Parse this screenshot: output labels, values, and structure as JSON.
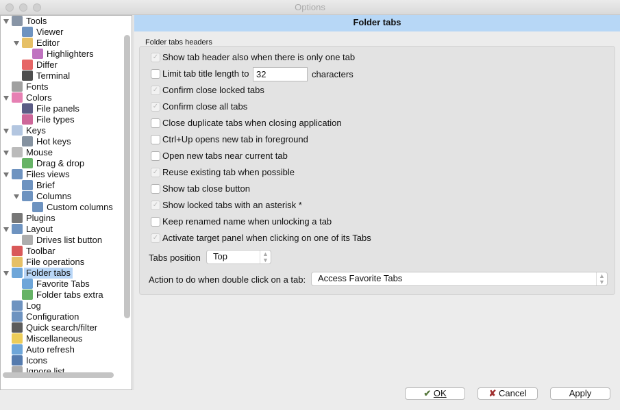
{
  "window": {
    "title": "Options"
  },
  "tree": [
    {
      "label": "Tools",
      "level": 0,
      "expanded": true,
      "icon": "tools-icon",
      "color": "#6a7a90"
    },
    {
      "label": "Viewer",
      "level": 1,
      "icon": "viewer-icon",
      "color": "#4a78b0"
    },
    {
      "label": "Editor",
      "level": 1,
      "expanded": true,
      "icon": "editor-icon",
      "color": "#e0b040"
    },
    {
      "label": "Highlighters",
      "level": 2,
      "icon": "highlighters-icon",
      "color": "#b050b0"
    },
    {
      "label": "Differ",
      "level": 1,
      "icon": "differ-icon",
      "color": "#e04040"
    },
    {
      "label": "Terminal",
      "level": 1,
      "icon": "terminal-icon",
      "color": "#222222"
    },
    {
      "label": "Fonts",
      "level": 0,
      "icon": "fonts-icon",
      "color": "#888888"
    },
    {
      "label": "Colors",
      "level": 0,
      "expanded": true,
      "icon": "colors-icon",
      "color": "#e060a0"
    },
    {
      "label": "File panels",
      "level": 1,
      "icon": "file-panels-icon",
      "color": "#333366"
    },
    {
      "label": "File types",
      "level": 1,
      "icon": "file-types-icon",
      "color": "#c04080"
    },
    {
      "label": "Keys",
      "level": 0,
      "expanded": true,
      "icon": "keyboard-icon",
      "color": "#a0b8d8"
    },
    {
      "label": "Hot keys",
      "level": 1,
      "icon": "hot-keys-icon",
      "color": "#667788"
    },
    {
      "label": "Mouse",
      "level": 0,
      "expanded": true,
      "icon": "mouse-icon",
      "color": "#aaaaaa"
    },
    {
      "label": "Drag & drop",
      "level": 1,
      "icon": "drag-drop-icon",
      "color": "#40a040"
    },
    {
      "label": "Files views",
      "level": 0,
      "expanded": true,
      "icon": "files-views-icon",
      "color": "#4a78b0"
    },
    {
      "label": "Brief",
      "level": 1,
      "icon": "brief-icon",
      "color": "#4a78b0"
    },
    {
      "label": "Columns",
      "level": 1,
      "expanded": true,
      "icon": "columns-icon",
      "color": "#4a78b0"
    },
    {
      "label": "Custom columns",
      "level": 2,
      "icon": "custom-columns-icon",
      "color": "#4a78b0"
    },
    {
      "label": "Plugins",
      "level": 0,
      "icon": "plugins-icon",
      "color": "#555555"
    },
    {
      "label": "Layout",
      "level": 0,
      "expanded": true,
      "icon": "layout-icon",
      "color": "#4a78b0"
    },
    {
      "label": "Drives list button",
      "level": 1,
      "icon": "drives-list-icon",
      "color": "#999999"
    },
    {
      "label": "Toolbar",
      "level": 0,
      "icon": "toolbar-icon",
      "color": "#d03030"
    },
    {
      "label": "File operations",
      "level": 0,
      "icon": "file-operations-icon",
      "color": "#e0b040"
    },
    {
      "label": "Folder tabs",
      "level": 0,
      "expanded": true,
      "selected": true,
      "icon": "folder-tabs-icon",
      "color": "#4a90d0"
    },
    {
      "label": "Favorite Tabs",
      "level": 1,
      "icon": "favorite-tabs-icon",
      "color": "#4a90d0"
    },
    {
      "label": "Folder tabs extra",
      "level": 1,
      "icon": "folder-tabs-extra-icon",
      "color": "#40a040"
    },
    {
      "label": "Log",
      "level": 0,
      "icon": "log-icon",
      "color": "#4a78b0"
    },
    {
      "label": "Configuration",
      "level": 0,
      "icon": "configuration-icon",
      "color": "#4a78b0"
    },
    {
      "label": "Quick search/filter",
      "level": 0,
      "icon": "quick-search-icon",
      "color": "#333333"
    },
    {
      "label": "Miscellaneous",
      "level": 0,
      "icon": "miscellaneous-icon",
      "color": "#e8c030"
    },
    {
      "label": "Auto refresh",
      "level": 0,
      "icon": "auto-refresh-icon",
      "color": "#4a90d0"
    },
    {
      "label": "Icons",
      "level": 0,
      "icon": "icons-icon",
      "color": "#2a5a9a"
    },
    {
      "label": "Ignore list",
      "level": 0,
      "icon": "ignore-list-icon",
      "color": "#999999"
    }
  ],
  "page": {
    "title": "Folder tabs",
    "group_title": "Folder tabs headers"
  },
  "options": [
    {
      "label": "Show tab header also when there is only one tab",
      "checked": true,
      "disabled": true
    },
    {
      "label": "Limit tab title length to",
      "checked": false,
      "disabled": false
    },
    {
      "label": "Confirm close locked tabs",
      "checked": true,
      "disabled": true
    },
    {
      "label": "Confirm close all tabs",
      "checked": true,
      "disabled": true
    },
    {
      "label": "Close duplicate tabs when closing application",
      "checked": false
    },
    {
      "label": "Ctrl+Up opens new tab in foreground",
      "checked": false
    },
    {
      "label": "Open new tabs near current tab",
      "checked": false
    },
    {
      "label": "Reuse existing tab when possible",
      "checked": true,
      "disabled": true
    },
    {
      "label": "Show tab close button",
      "checked": false
    },
    {
      "label": "Show locked tabs with an asterisk *",
      "checked": true,
      "disabled": true
    },
    {
      "label": "Keep renamed name when unlocking a tab",
      "checked": false
    },
    {
      "label": "Activate target panel when clicking on one of its Tabs",
      "checked": true,
      "disabled": true
    }
  ],
  "limit": {
    "value": "32",
    "suffix": "characters"
  },
  "tabs_position": {
    "label": "Tabs position",
    "value": "Top"
  },
  "double_click": {
    "label": "Action to do when double click on a tab:",
    "value": "Access Favorite Tabs"
  },
  "buttons": {
    "ok": "OK",
    "cancel": "Cancel",
    "apply": "Apply"
  }
}
